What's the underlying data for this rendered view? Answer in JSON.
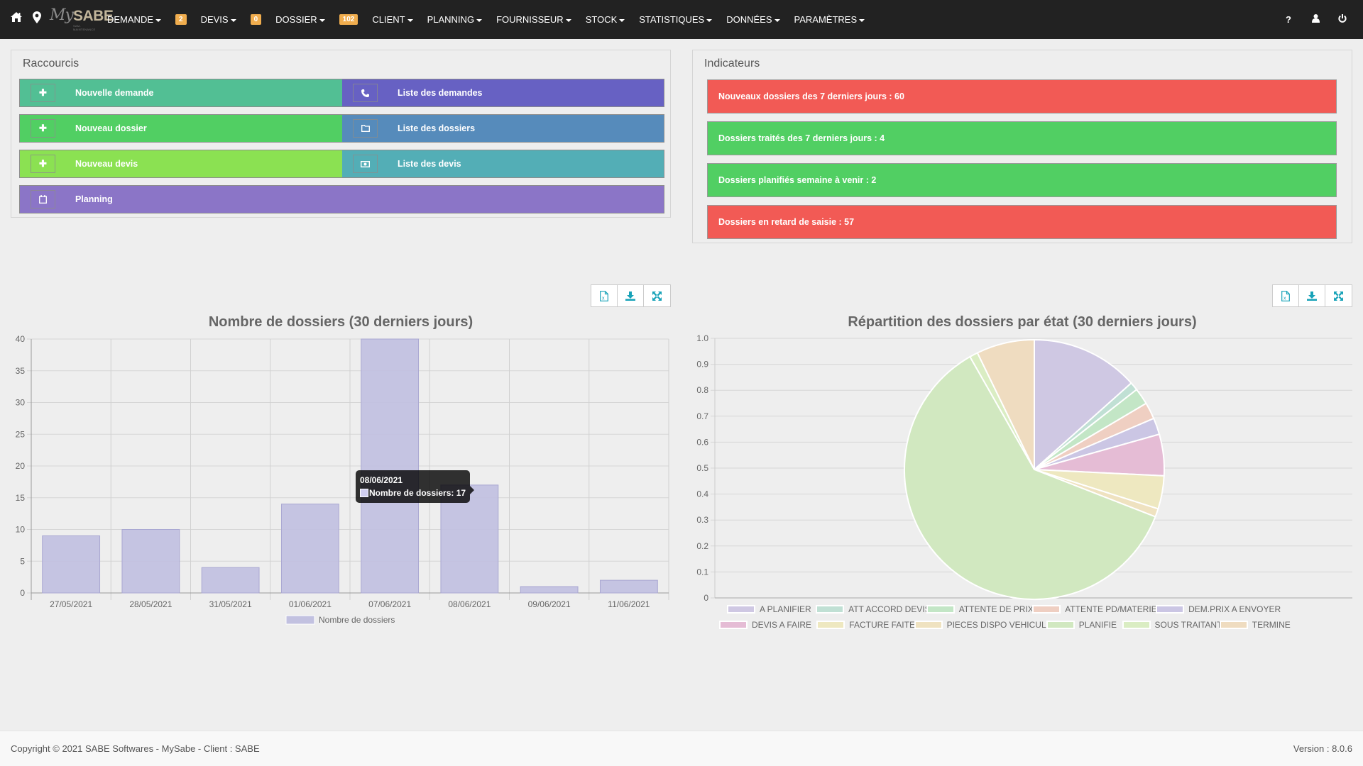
{
  "navbar": {
    "logo_my": "My",
    "logo_sabe": "SABE",
    "logo_sub": "SAM-MAINTENANCE",
    "left_icons": [
      "home-icon",
      "map-marker-icon"
    ],
    "menu": [
      {
        "label": "DEMANDE",
        "badge": "2"
      },
      {
        "label": "DEVIS",
        "badge": "0"
      },
      {
        "label": "DOSSIER",
        "badge": "102"
      },
      {
        "label": "CLIENT",
        "badge": null
      },
      {
        "label": "PLANNING",
        "badge": null
      },
      {
        "label": "FOURNISSEUR",
        "badge": null
      },
      {
        "label": "STOCK",
        "badge": null
      },
      {
        "label": "STATISTIQUES",
        "badge": null
      },
      {
        "label": "DONNÉES",
        "badge": null
      },
      {
        "label": "PARAMÈTRES",
        "badge": null
      }
    ],
    "right_icons": [
      "help-icon",
      "user-icon",
      "power-icon"
    ],
    "help_glyph": "?"
  },
  "shortcuts": {
    "title": "Raccourcis",
    "items": [
      {
        "label": "Nouvelle demande",
        "icon": "plus-icon",
        "color": "#52bf94"
      },
      {
        "label": "Liste des demandes",
        "icon": "phone-icon",
        "color": "#6761c3"
      },
      {
        "label": "Nouveau dossier",
        "icon": "plus-icon",
        "color": "#51cf63"
      },
      {
        "label": "Liste des dossiers",
        "icon": "folder-icon",
        "color": "#568bbb"
      },
      {
        "label": "Nouveau devis",
        "icon": "plus-icon",
        "color": "#8be152"
      },
      {
        "label": "Liste des devis",
        "icon": "money-icon",
        "color": "#53aeb6"
      },
      {
        "label": "Planning",
        "icon": "calendar-icon",
        "color": "#8b75c7"
      }
    ]
  },
  "indicators": {
    "title": "Indicateurs",
    "items": [
      {
        "label": "Nouveaux dossiers des 7 derniers jours : 60",
        "color": "#f25a55"
      },
      {
        "label": "Dossiers traités des 7 derniers jours : 4",
        "color": "#51cf63"
      },
      {
        "label": "Dossiers planifiés semaine à venir : 2",
        "color": "#51cf63"
      },
      {
        "label": "Dossiers en retard de saisie : 57",
        "color": "#f25a55"
      }
    ]
  },
  "chart_toolbar": [
    "excel-export-icon",
    "download-icon",
    "fullscreen-icon"
  ],
  "tooltip": {
    "title": "08/06/2021",
    "body": "Nombre de dossiers: 17"
  },
  "footer": {
    "copyright": "Copyright © 2021 SABE Softwares - MySabe - Client : SABE",
    "version": "Version : 8.0.6"
  },
  "chart_data": [
    {
      "type": "bar",
      "title": "Nombre de dossiers (30 derniers jours)",
      "categories": [
        "27/05/2021",
        "28/05/2021",
        "31/05/2021",
        "01/06/2021",
        "07/06/2021",
        "08/06/2021",
        "09/06/2021",
        "11/06/2021"
      ],
      "series": [
        {
          "name": "Nombre de dossiers",
          "values": [
            9,
            10,
            4,
            14,
            40,
            17,
            1,
            2
          ],
          "color": "#c2c1e0"
        }
      ],
      "yticks": [
        0,
        5,
        10,
        15,
        20,
        25,
        30,
        35,
        40
      ],
      "ylim": [
        0,
        40
      ],
      "xlabel": "",
      "ylabel": "",
      "grid": true,
      "legend": "bottom"
    },
    {
      "type": "pie",
      "title": "Répartition des dossiers par état (30 derniers jours)",
      "labels": [
        "A PLANIFIER",
        "ATT ACCORD DEVIS",
        "ATTENTE DE PRIX",
        "ATTENTE PD/MATERIEL",
        "DEM.PRIX A ENVOYER",
        "DEVIS A FAIRE",
        "FACTURE FAITE",
        "PIECES DISPO VEHICULE",
        "PLANIFIE",
        "SOUS TRAITANT",
        "TERMINE"
      ],
      "values": [
        13,
        1,
        2,
        2,
        2,
        5,
        4,
        1,
        59,
        1,
        7
      ],
      "colors": [
        "#cfc8e3",
        "#c0e0d4",
        "#c3e6c6",
        "#efcfc2",
        "#cbc6e4",
        "#e5bcd5",
        "#eee8c0",
        "#efe2c0",
        "#d1e8c0",
        "#daedc3",
        "#efdcc0"
      ],
      "yticks": [
        "0",
        "0.1",
        "0.2",
        "0.3",
        "0.4",
        "0.5",
        "0.6",
        "0.7",
        "0.8",
        "0.9",
        "1.0"
      ],
      "grid": true,
      "legend": "bottom"
    }
  ]
}
